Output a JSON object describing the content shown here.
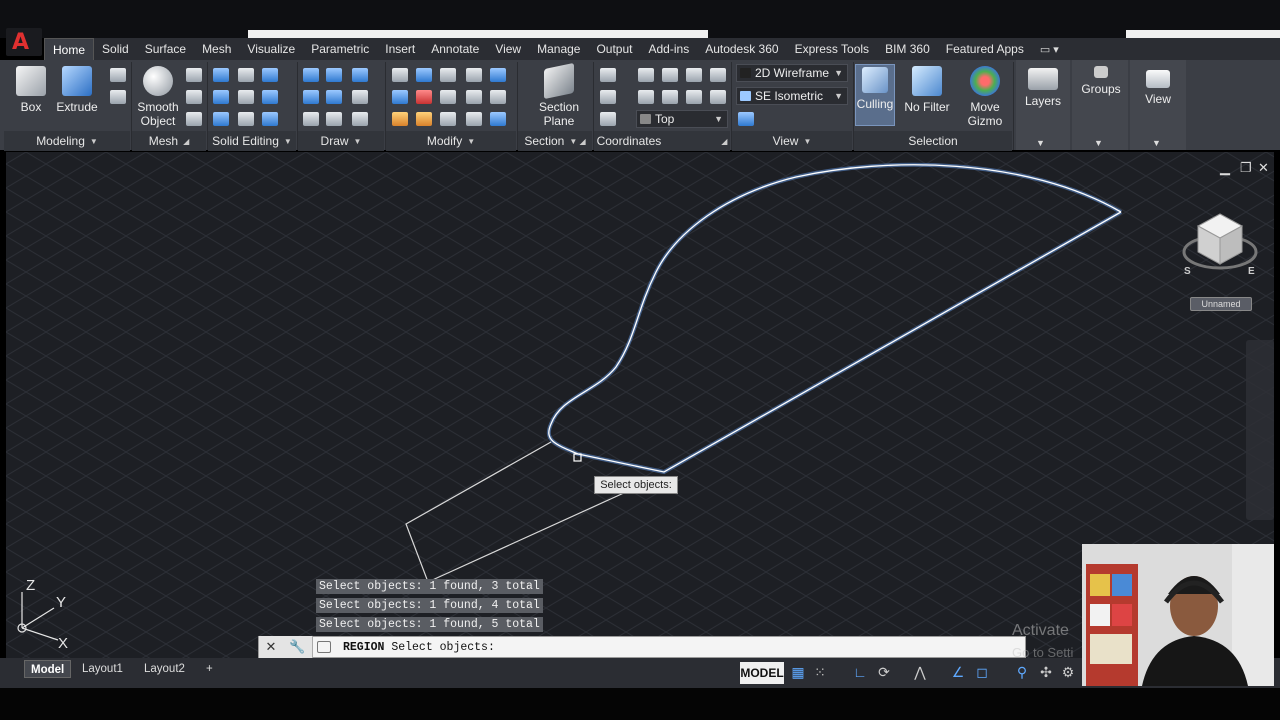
{
  "app": {
    "logo_letter": "A"
  },
  "tabs": [
    "Home",
    "Solid",
    "Surface",
    "Mesh",
    "Visualize",
    "Parametric",
    "Insert",
    "Annotate",
    "View",
    "Manage",
    "Output",
    "Add-ins",
    "Autodesk 360",
    "Express Tools",
    "BIM 360",
    "Featured Apps"
  ],
  "ribbon": {
    "buttons": {
      "box": "Box",
      "extrude": "Extrude",
      "smooth_object_1": "Smooth",
      "smooth_object_2": "Object",
      "section_plane_1": "Section",
      "section_plane_2": "Plane",
      "culling": "Culling",
      "no_filter": "No Filter",
      "move_gizmo_1": "Move",
      "move_gizmo_2": "Gizmo",
      "layers": "Layers",
      "groups": "Groups",
      "view": "View"
    },
    "dropdowns": {
      "visual_style": "2D Wireframe",
      "view_preset": "SE Isometric",
      "ucs": "Top"
    },
    "panels": [
      "Modeling",
      "Mesh",
      "Solid Editing",
      "Draw",
      "Modify",
      "Section",
      "Coordinates",
      "View",
      "Selection"
    ]
  },
  "viewport": {
    "named_view": "Unnamed",
    "tooltip": "Select objects:",
    "axis_labels": {
      "x": "X",
      "y": "Y",
      "z": "Z"
    },
    "compass": {
      "s": "S",
      "e": "E"
    }
  },
  "command": {
    "history": [
      "Select objects: 1 found, 3 total",
      "Select objects: 1 found, 4 total",
      "Select objects: 1 found, 5 total"
    ],
    "name": "REGION",
    "prompt": "Select objects:"
  },
  "watermark": {
    "line1": "Activate",
    "line2": "Go to Setti"
  },
  "layout_tabs": [
    "Model",
    "Layout1",
    "Layout2"
  ],
  "status": {
    "space": "MODEL"
  },
  "colors": {
    "selection": "#7fb6ff",
    "viewport_bg": "#1d1f24"
  }
}
